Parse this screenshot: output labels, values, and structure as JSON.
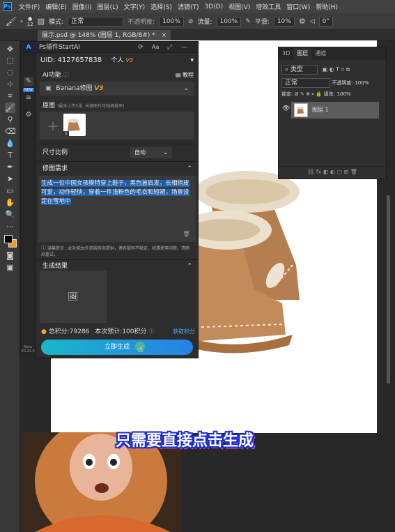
{
  "menubar": {
    "logo": "Ps",
    "items": [
      "文件(F)",
      "编辑(E)",
      "图像(I)",
      "图层(L)",
      "文字(Y)",
      "选择(S)",
      "滤镜(T)",
      "3D(D)",
      "视图(V)",
      "增效工具",
      "窗口(W)",
      "帮助(H)"
    ]
  },
  "options": {
    "brush_size": "12",
    "mode_label": "模式:",
    "mode_value": "正常",
    "opacity_label": "不透明度:",
    "opacity_value": "100%",
    "flow_label": "流量:",
    "flow_value": "100%",
    "smooth_label": "平滑:",
    "smooth_value": "10%",
    "angle_value": "0°"
  },
  "doc_tab": {
    "title": "展示.psd @ 148% (图层 1, RGB/8#) *",
    "close": "×"
  },
  "plugin": {
    "title": "Ps插件StartAI",
    "logo": "A",
    "uid": "UID: 4127657838",
    "account": "个人",
    "version_badge": "V3",
    "ai_label": "AI功能",
    "tutorial": "教程",
    "ai_select": "Banana修图",
    "ai_select_badge": "V3",
    "original_label": "原图",
    "original_hint": "(最多上传5张, 长按图片可拖拽排序)",
    "thumb_index": "1",
    "ratio_label": "尺寸比例",
    "ratio_value": "自动",
    "need_label": "修图需求",
    "prompt": "生成一位中国女孩模特穿上鞋子，黑色披肩发，长相俏皮可爱，动作轻快，穿着一件浅粉色的毛衣和短裙，场景设定在雪地中",
    "tip": "温馨提示：此功能由外部服务商提供，偶有服务不稳定，如遇使用问题，请稍后重试。",
    "result_label": "生成结果",
    "points_total": "总积分:79286",
    "points_estimate": "本次预计:100积分",
    "earn_points": "获取积分",
    "generate_button": "立即生成",
    "neta_label": "Neta",
    "neta_version": "V0.21.0",
    "new_badge": "NEW"
  },
  "layers": {
    "tabs": [
      "3D",
      "图层",
      "通道"
    ],
    "kind_label": "类型",
    "blend_mode": "正常",
    "opacity_label": "不透明度:",
    "opacity_value": "100%",
    "lock_label": "锁定:",
    "fill_label": "填充:",
    "fill_value": "100%",
    "layer_name": "图层 1",
    "bottom_icons": "⛓  fx  ◧  ◐  ▢  ⊞  🗑"
  },
  "caption": "只需要直接点击生成",
  "colors": {
    "accent": "#2780e8",
    "caption_outline": "#1a2fd1",
    "badge": "#f5a623"
  }
}
